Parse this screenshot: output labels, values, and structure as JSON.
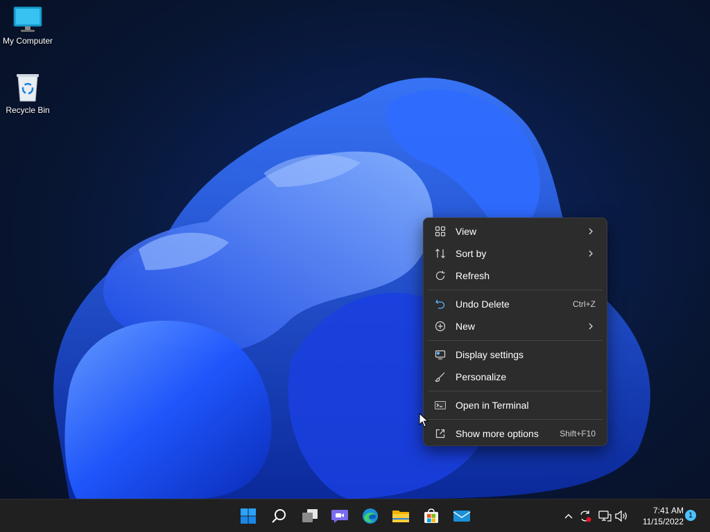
{
  "desktop": {
    "icons": [
      {
        "label": "My Computer",
        "icon": "monitor-icon"
      },
      {
        "label": "Recycle Bin",
        "icon": "recycle-bin-icon"
      }
    ]
  },
  "context_menu": {
    "items": [
      {
        "label": "View",
        "icon": "grid-icon",
        "submenu": true
      },
      {
        "label": "Sort by",
        "icon": "sort-icon",
        "submenu": true
      },
      {
        "label": "Refresh",
        "icon": "refresh-icon"
      },
      {
        "label": "Undo Delete",
        "icon": "undo-icon",
        "shortcut": "Ctrl+Z"
      },
      {
        "label": "New",
        "icon": "plus-circle-icon",
        "submenu": true
      },
      {
        "label": "Display settings",
        "icon": "display-icon"
      },
      {
        "label": "Personalize",
        "icon": "brush-icon"
      },
      {
        "label": "Open in Terminal",
        "icon": "terminal-icon"
      },
      {
        "label": "Show more options",
        "icon": "external-icon",
        "shortcut": "Shift+F10"
      }
    ]
  },
  "taskbar": {
    "apps": [
      "windows-start-icon",
      "search-icon",
      "task-view-icon",
      "chat-icon",
      "edge-icon",
      "file-explorer-icon",
      "store-icon",
      "mail-icon"
    ],
    "tray": [
      "chevron-up-icon",
      "sync-icon",
      "network-icon",
      "volume-icon"
    ],
    "clock": {
      "time": "7:41 AM",
      "date": "11/15/2022"
    },
    "notification_count": "1"
  },
  "colors": {
    "accent": "#4cc2ff",
    "menu_bg": "#2c2c2c",
    "taskbar_bg": "#202020"
  }
}
